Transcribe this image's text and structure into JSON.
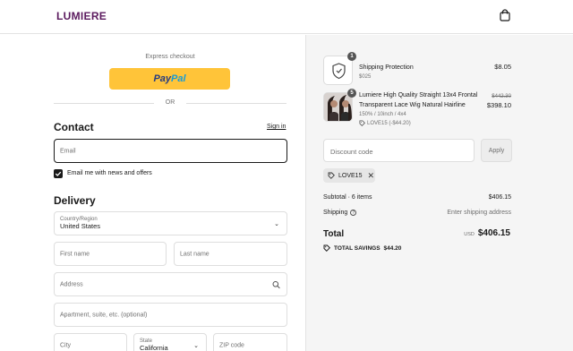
{
  "header": {
    "logo": "LUMIERE",
    "cart_icon": "shopping-bag-icon"
  },
  "express": {
    "label": "Express checkout",
    "paypal_1": "Pay",
    "paypal_2": "Pal",
    "or": "OR"
  },
  "contact": {
    "title": "Contact",
    "signin": "Sign in",
    "email_placeholder": "Email",
    "newsletter_label": "Email me with news and offers",
    "newsletter_checked": true
  },
  "delivery": {
    "title": "Delivery",
    "country_label": "Country/Region",
    "country_value": "United States",
    "first_name": "First name",
    "last_name": "Last name",
    "address": "Address",
    "apartment": "Apartment, suite, etc. (optional)",
    "city": "City",
    "state_label": "State",
    "state_value": "California",
    "zip": "ZIP code"
  },
  "summary": {
    "items": [
      {
        "qty": "1",
        "name": "Shipping Protection",
        "sub": "$025",
        "price": "$8.05"
      },
      {
        "qty": "5",
        "name_line1": "Lumiere High Quality Straight 13x4 Frontal",
        "name_line2": "Transparent Lace Wig Natural Hairline",
        "variant": "150% / 10inch / 4x4",
        "discount": "LOVE15 (-$44.20)",
        "original_price": "$442.30",
        "price": "$398.10"
      }
    ],
    "discount_placeholder": "Discount code",
    "apply": "Apply",
    "applied_code": "LOVE15",
    "subtotal_label": "Subtotal · 6 items",
    "subtotal_value": "$406.15",
    "shipping_label": "Shipping",
    "shipping_value": "Enter shipping address",
    "total_label": "Total",
    "currency": "USD",
    "total_value": "$406.15",
    "savings_label": "TOTAL SAVINGS",
    "savings_value": "$44.20"
  },
  "colors": {
    "brand": "#5b1a5e",
    "paypal": "#ffc439",
    "summary_bg": "#f5f5f5"
  }
}
